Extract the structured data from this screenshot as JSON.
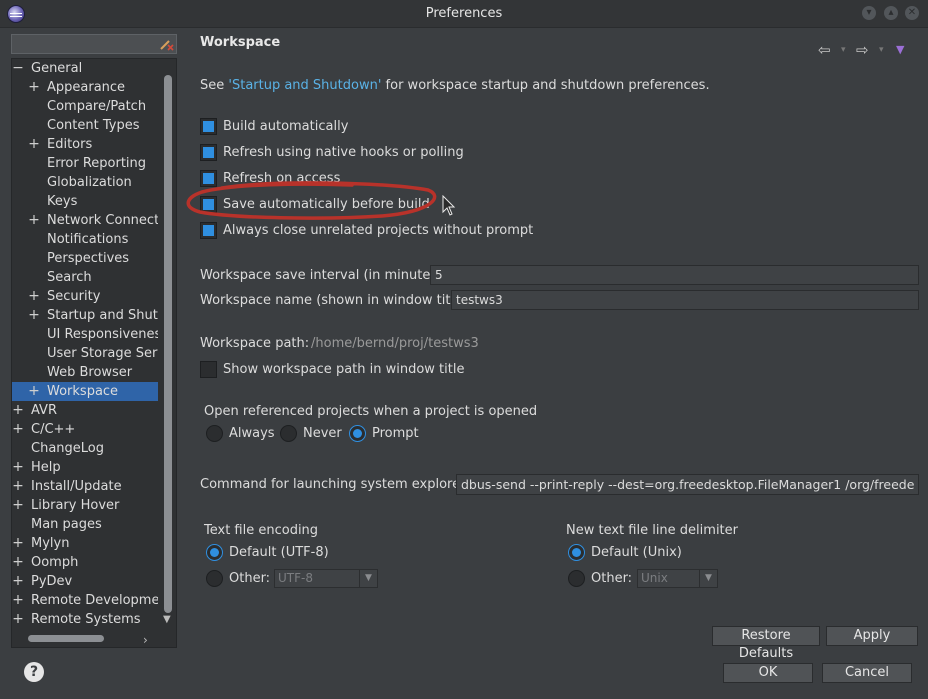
{
  "window": {
    "title": "Preferences"
  },
  "filter": {
    "value": ""
  },
  "tree": {
    "items": [
      {
        "label": "General",
        "expander": "−"
      },
      {
        "label": "Appearance",
        "expander": "+"
      },
      {
        "label": "Compare/Patch",
        "expander": ""
      },
      {
        "label": "Content Types",
        "expander": ""
      },
      {
        "label": "Editors",
        "expander": "+"
      },
      {
        "label": "Error Reporting",
        "expander": ""
      },
      {
        "label": "Globalization",
        "expander": ""
      },
      {
        "label": "Keys",
        "expander": ""
      },
      {
        "label": "Network Connecti",
        "expander": "+"
      },
      {
        "label": "Notifications",
        "expander": ""
      },
      {
        "label": "Perspectives",
        "expander": ""
      },
      {
        "label": "Search",
        "expander": ""
      },
      {
        "label": "Security",
        "expander": "+"
      },
      {
        "label": "Startup and Shutd",
        "expander": "+"
      },
      {
        "label": "UI Responsivenes",
        "expander": ""
      },
      {
        "label": "User Storage Serv",
        "expander": ""
      },
      {
        "label": "Web Browser",
        "expander": ""
      },
      {
        "label": "Workspace",
        "expander": "+",
        "selected": true
      },
      {
        "label": "AVR",
        "expander": "+"
      },
      {
        "label": "C/C++",
        "expander": "+"
      },
      {
        "label": "ChangeLog",
        "expander": ""
      },
      {
        "label": "Help",
        "expander": "+"
      },
      {
        "label": "Install/Update",
        "expander": "+"
      },
      {
        "label": "Library Hover",
        "expander": "+"
      },
      {
        "label": "Man pages",
        "expander": ""
      },
      {
        "label": "Mylyn",
        "expander": "+"
      },
      {
        "label": "Oomph",
        "expander": "+"
      },
      {
        "label": "PyDev",
        "expander": "+"
      },
      {
        "label": "Remote Developmer",
        "expander": "+"
      },
      {
        "label": "Remote Systems",
        "expander": "+"
      }
    ]
  },
  "page": {
    "title": "Workspace",
    "intro_prefix": "See ",
    "intro_link": "'Startup and Shutdown'",
    "intro_suffix": " for workspace startup and shutdown preferences.",
    "checkboxes": {
      "build_auto": {
        "label": "Build automatically",
        "checked": true
      },
      "refresh_native": {
        "label": "Refresh using native hooks or polling",
        "checked": true
      },
      "refresh_access": {
        "label": "Refresh on access",
        "checked": true
      },
      "save_before_build": {
        "label": "Save automatically before build",
        "checked": true
      },
      "close_unrelated": {
        "label": "Always close unrelated projects without prompt",
        "checked": true
      }
    },
    "save_interval": {
      "label": "Workspace save interval (in minutes):",
      "value": "5"
    },
    "ws_name": {
      "label": "Workspace name (shown in window title):",
      "value": "testws3"
    },
    "ws_path": {
      "label": "Workspace path:",
      "value": "/home/bernd/proj/testws3"
    },
    "show_path": {
      "label": "Show workspace path in window title",
      "checked": false
    },
    "open_ref": {
      "label": "Open referenced projects when a project is opened",
      "options": [
        "Always",
        "Never",
        "Prompt"
      ],
      "selected": "Prompt"
    },
    "explorer_cmd": {
      "label": "Command for launching system explorer:",
      "value": "dbus-send --print-reply --dest=org.freedesktop.FileManager1 /org/freedes"
    },
    "encoding": {
      "label": "Text file encoding",
      "default_label": "Default (UTF-8)",
      "other_label": "Other:",
      "other_value": "UTF-8",
      "selected": "default"
    },
    "line_delim": {
      "label": "New text file line delimiter",
      "default_label": "Default (Unix)",
      "other_label": "Other:",
      "other_value": "Unix",
      "selected": "default"
    }
  },
  "buttons": {
    "restore_defaults": "Restore Defaults",
    "apply": "Apply",
    "ok": "OK",
    "cancel": "Cancel"
  },
  "colors": {
    "accent": "#2f8fe0",
    "selection": "#2f64a8",
    "link": "#5ab2e6",
    "annotation": "#c0392b"
  }
}
